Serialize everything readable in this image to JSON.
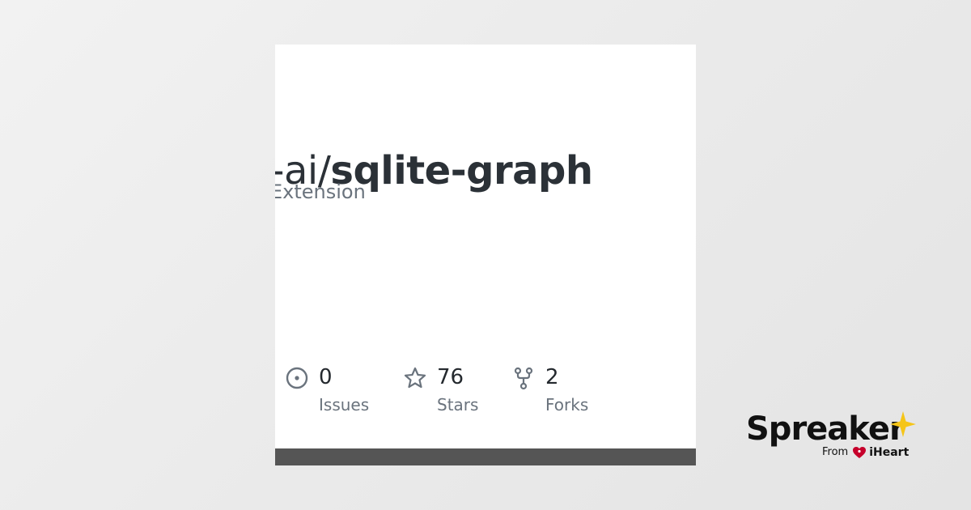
{
  "repo": {
    "owner_fragment": "are-ai/",
    "name": "sqlite-graph",
    "description_fragment": "Extension"
  },
  "stats": [
    {
      "value": "0",
      "label": "Issues",
      "icon": "issue-circle-icon"
    },
    {
      "value": "76",
      "label": "Stars",
      "icon": "star-icon"
    },
    {
      "value": "2",
      "label": "Forks",
      "icon": "fork-icon"
    }
  ],
  "brand": {
    "name": "Spreaker",
    "from_label": "From",
    "partner": "iHeart",
    "star_color": "#f5c518",
    "heart_color": "#c6002b"
  },
  "colors": {
    "title": "#2b3137",
    "muted": "#6a737d",
    "bar": "#555555"
  }
}
